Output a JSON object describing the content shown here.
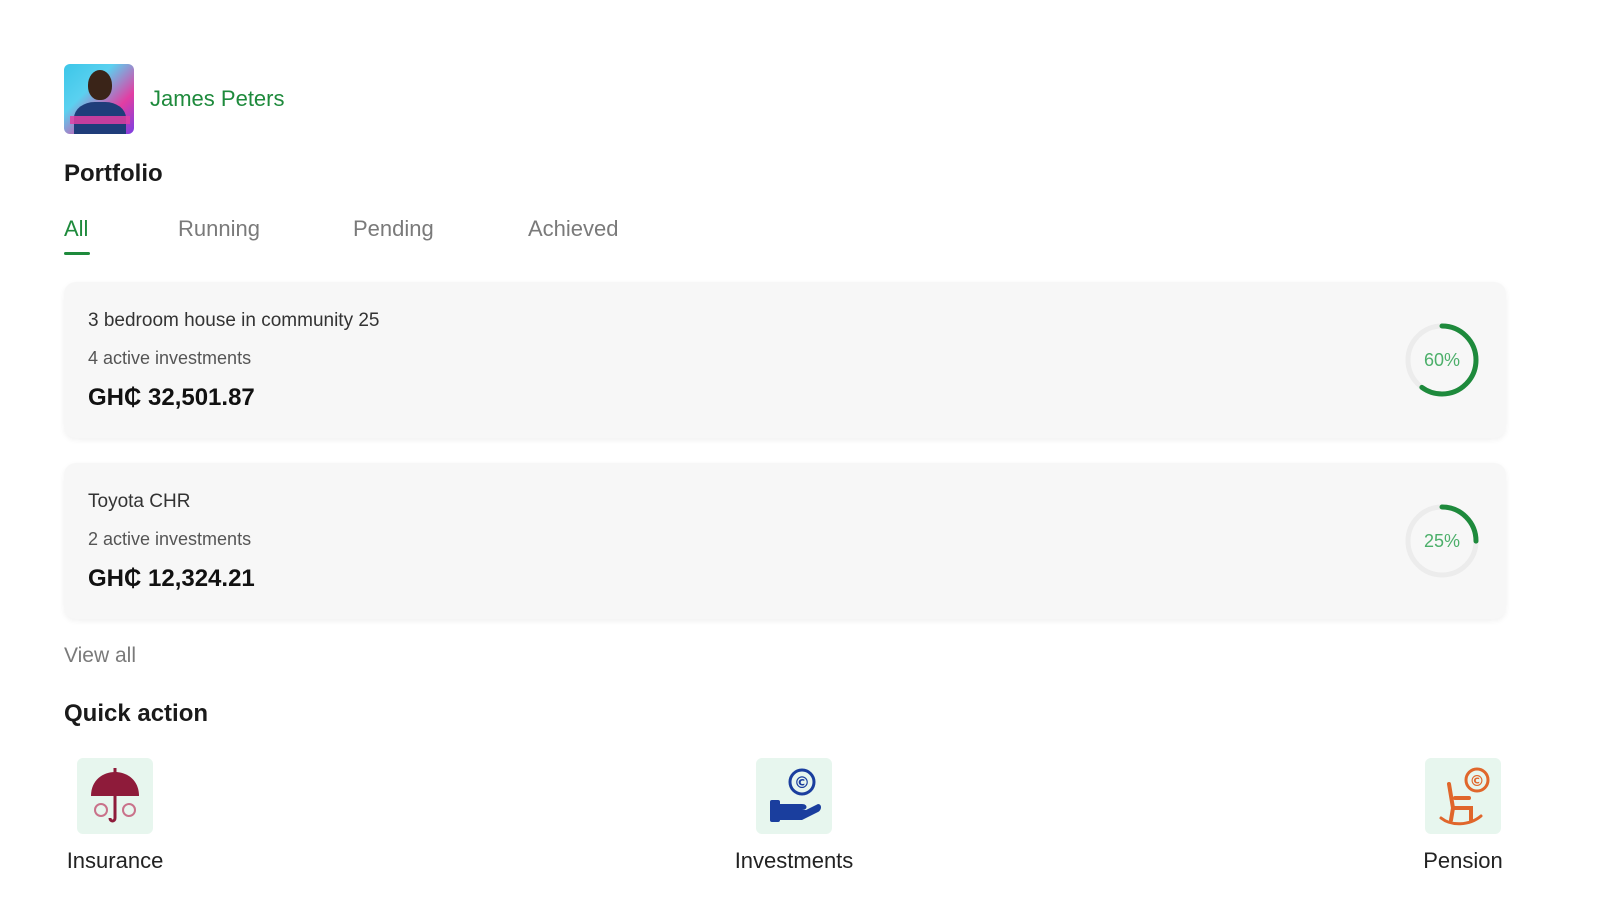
{
  "profile": {
    "name": "James Peters"
  },
  "portfolio": {
    "title": "Portfolio",
    "tabs": [
      {
        "label": "All",
        "active": true
      },
      {
        "label": "Running",
        "active": false
      },
      {
        "label": "Pending",
        "active": false
      },
      {
        "label": "Achieved",
        "active": false
      }
    ],
    "cards": [
      {
        "name": "3 bedroom house in community 25",
        "investments": "4 active investments",
        "amount": "GH₵ 32,501.87",
        "progress_label": "60%",
        "progress": 0.6
      },
      {
        "name": "Toyota CHR",
        "investments": "2 active investments",
        "amount": "GH₵ 12,324.21",
        "progress_label": "25%",
        "progress": 0.25
      }
    ],
    "view_all": "View all"
  },
  "quick_action": {
    "title": "Quick action",
    "items": [
      {
        "label": "Insurance",
        "icon": "umbrella-icon"
      },
      {
        "label": "Investments",
        "icon": "hand-coin-icon"
      },
      {
        "label": "Pension",
        "icon": "rocking-chair-icon"
      }
    ]
  },
  "colors": {
    "accent": "#1e8a3c",
    "ring_track": "#ececec",
    "tile_bg": "#e7f6ee"
  }
}
